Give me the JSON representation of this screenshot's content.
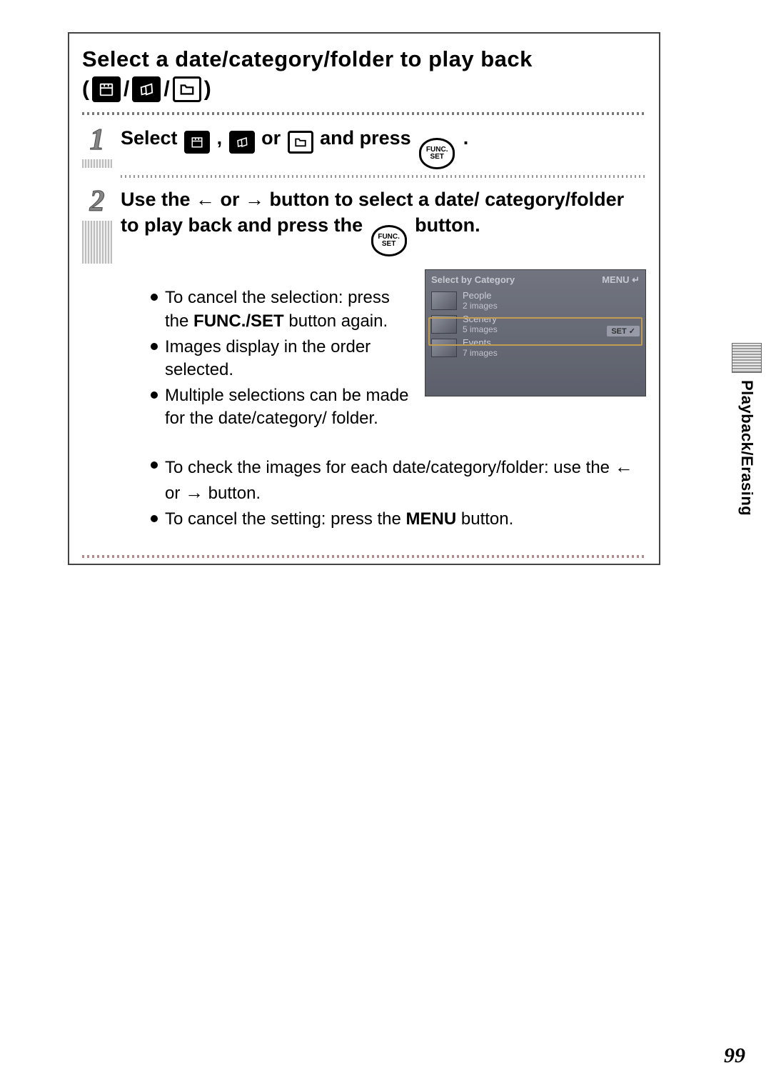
{
  "heading": "Select a date/category/folder to play back",
  "iconbar": {
    "open": "(",
    "sep": "/",
    "close": ")"
  },
  "step1": {
    "num": "1",
    "pre": "Select ",
    "mid1": ", ",
    "mid2": " or ",
    "post": " and press ",
    "end": "."
  },
  "func": {
    "top": "FUNC.",
    "bot": "SET"
  },
  "step2": {
    "num": "2",
    "line": "Use the ← or → button to select a date/ category/folder to play back and press the ",
    "tail": " button."
  },
  "bulletsA": [
    {
      "pre": "To cancel the selection: press the ",
      "bold": "FUNC./SET",
      "post": " button again."
    },
    {
      "pre": "Images display in the order selected.",
      "bold": "",
      "post": ""
    },
    {
      "pre": "Multiple selections can be made for the date/category/ folder.",
      "bold": "",
      "post": ""
    }
  ],
  "bulletsB": [
    {
      "pre": "To check the images for each date/category/folder: use the ",
      "arrows": true,
      "post": " button."
    },
    {
      "pre": "To cancel the setting: press the ",
      "bold": "MENU",
      "post": " button."
    }
  ],
  "arrows": {
    "left": "←",
    "or": " or ",
    "right": "→"
  },
  "screen": {
    "title": "Select by Category",
    "menu": "MENU ↵",
    "rows": [
      {
        "cat": "People",
        "count": "2 images"
      },
      {
        "cat": "Scenery",
        "count": "5 images"
      },
      {
        "cat": "Events",
        "count": "7 images"
      }
    ],
    "set": "SET ✓"
  },
  "tab": "Playback/Erasing",
  "pageNumber": "99"
}
